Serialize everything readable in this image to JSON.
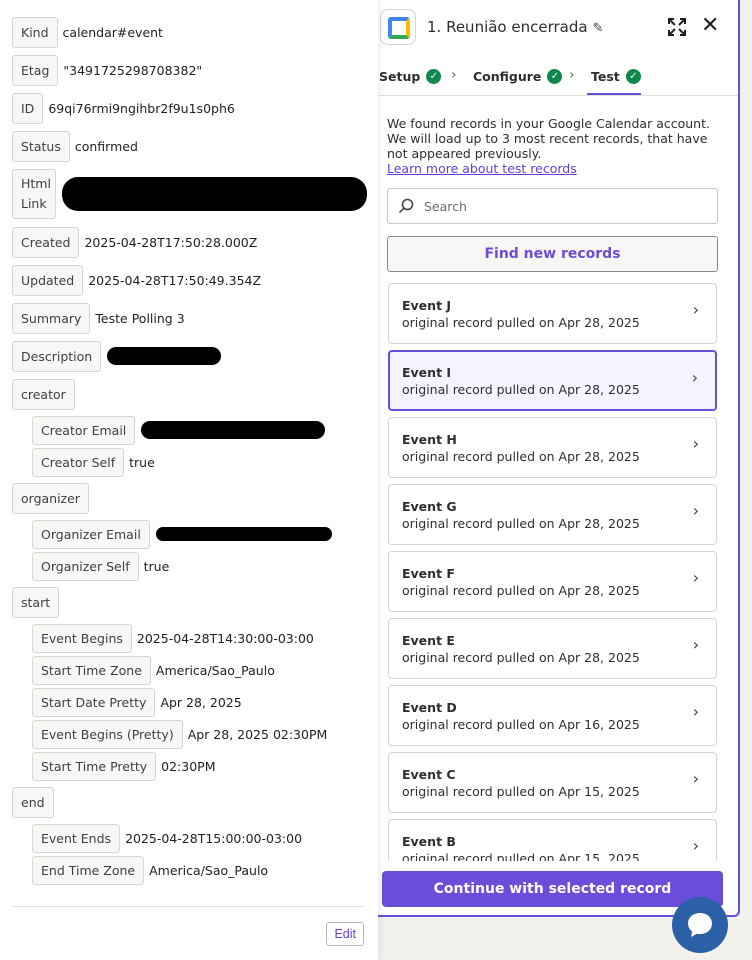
{
  "record_fields": {
    "kind": {
      "label": "Kind",
      "value": "calendar#event"
    },
    "etag": {
      "label": "Etag",
      "value": "\"3491725298708382\""
    },
    "id": {
      "label": "ID",
      "value": "69qi76rmi9ngihbr2f9u1s0ph6"
    },
    "status": {
      "label": "Status",
      "value": "confirmed"
    },
    "html_link": {
      "label": "Html Link"
    },
    "created": {
      "label": "Created",
      "value": "2025-04-28T17:50:28.000Z"
    },
    "updated": {
      "label": "Updated",
      "value": "2025-04-28T17:50:49.354Z"
    },
    "summary": {
      "label": "Summary",
      "value": "Teste Polling 3"
    },
    "description": {
      "label": "Description"
    },
    "creator": {
      "label": "creator"
    },
    "creator_email": {
      "label": "Creator Email"
    },
    "creator_self": {
      "label": "Creator Self",
      "value": "true"
    },
    "organizer": {
      "label": "organizer"
    },
    "organizer_email": {
      "label": "Organizer Email"
    },
    "organizer_self": {
      "label": "Organizer Self",
      "value": "true"
    },
    "start": {
      "label": "start"
    },
    "event_begins": {
      "label": "Event Begins",
      "value": "2025-04-28T14:30:00-03:00"
    },
    "start_time_zone": {
      "label": "Start Time Zone",
      "value": "America/Sao_Paulo"
    },
    "start_date_pretty": {
      "label": "Start Date Pretty",
      "value": "Apr 28, 2025"
    },
    "event_begins_pretty": {
      "label": "Event Begins (Pretty)",
      "value": "Apr 28, 2025 02:30PM"
    },
    "start_time_pretty": {
      "label": "Start Time Pretty",
      "value": "02:30PM"
    },
    "end": {
      "label": "end"
    },
    "event_ends": {
      "label": "Event Ends",
      "value": "2025-04-28T15:00:00-03:00"
    },
    "end_time_zone": {
      "label": "End Time Zone",
      "value": "America/Sao_Paulo"
    }
  },
  "left_footer": {
    "edit_label": "Edit"
  },
  "step": {
    "title": "1. Reunião encerrada",
    "tabs": [
      {
        "label": "Setup"
      },
      {
        "label": "Configure"
      },
      {
        "label": "Test"
      }
    ]
  },
  "test": {
    "info_text": "We found records in your Google Calendar account. We will load up to 3 most recent records, that have not appeared previously.",
    "learn_more": "Learn more about test records",
    "search_placeholder": "Search",
    "find_new": "Find new records",
    "records": [
      {
        "name": "Event J",
        "sub": "original record pulled on Apr 28, 2025"
      },
      {
        "name": "Event I",
        "sub": "original record pulled on Apr 28, 2025"
      },
      {
        "name": "Event H",
        "sub": "original record pulled on Apr 28, 2025"
      },
      {
        "name": "Event G",
        "sub": "original record pulled on Apr 28, 2025"
      },
      {
        "name": "Event F",
        "sub": "original record pulled on Apr 28, 2025"
      },
      {
        "name": "Event E",
        "sub": "original record pulled on Apr 28, 2025"
      },
      {
        "name": "Event D",
        "sub": "original record pulled on Apr 16, 2025"
      },
      {
        "name": "Event C",
        "sub": "original record pulled on Apr 15, 2025"
      },
      {
        "name": "Event B",
        "sub": "original record pulled on Apr 15, 2025"
      }
    ],
    "continue_label": "Continue with selected record"
  },
  "colors": {
    "accent": "#6a4dd8",
    "success": "#0f884e",
    "chat": "#2b5fa8"
  }
}
